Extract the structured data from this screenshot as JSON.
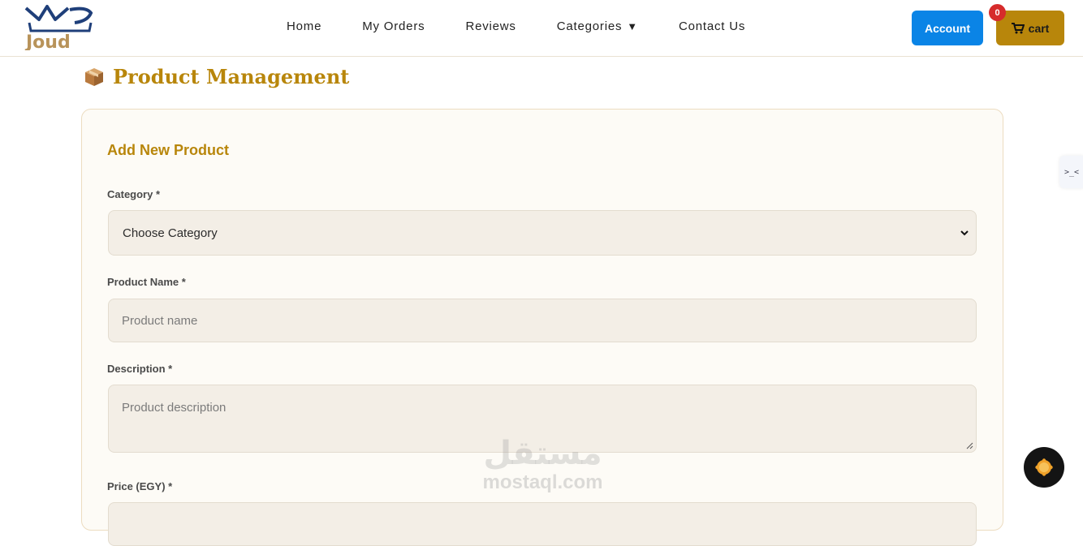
{
  "header": {
    "logo_text": "Joud",
    "nav": [
      {
        "label": "Home"
      },
      {
        "label": "My Orders"
      },
      {
        "label": "Reviews"
      },
      {
        "label": "Categories"
      },
      {
        "label": "Contact Us"
      }
    ],
    "categories_caret": "▼",
    "account_label": "Account",
    "cart_label": "cart",
    "cart_count": "0",
    "colors": {
      "account": "#0a84e6",
      "cart": "#b8860b",
      "badge": "#d62b2b"
    }
  },
  "page": {
    "title_icon": "package-box-icon",
    "title": "Product Management"
  },
  "form": {
    "title": "Add New Product",
    "category": {
      "label": "Category *",
      "value": "Choose Category"
    },
    "product_name": {
      "label": "Product Name *",
      "placeholder": "Product name"
    },
    "description": {
      "label": "Description *",
      "placeholder": "Product description"
    },
    "price": {
      "label": "Price (EGY) *"
    }
  },
  "watermark": {
    "arabic": "مستقل",
    "latin": "mostaql.com"
  },
  "side_tab": {
    "text": ">_<"
  },
  "accent_color": "#b8860b"
}
